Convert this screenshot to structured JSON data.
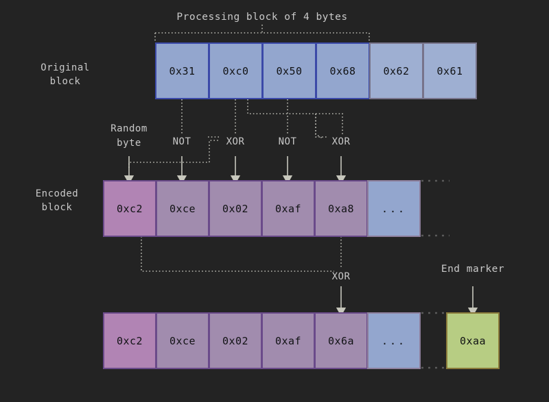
{
  "theme": {
    "background": "#232323",
    "text_light": "#c9c9c9",
    "text_dark": "#111214",
    "blue_fill": "#93a6ce",
    "blue_border_active": "#3b49a8",
    "blue_border_muted": "#77738a",
    "purple_fill_first": "#b184b4",
    "purple_fill": "#a18cae",
    "purple_border": "#6a4a8a",
    "green_fill": "#b7cd83",
    "green_border": "#8a7a3a",
    "connector": "#bdbdb5",
    "arrow": "#c8c8bd"
  },
  "captions": {
    "processing_block": "Processing block of 4 bytes",
    "end_marker": "End marker"
  },
  "rows": {
    "original": {
      "label_line1": "Original",
      "label_line2": "block",
      "cells": [
        {
          "value": "0x31",
          "state": "active"
        },
        {
          "value": "0xc0",
          "state": "active"
        },
        {
          "value": "0x50",
          "state": "active"
        },
        {
          "value": "0x68",
          "state": "active"
        },
        {
          "value": "0x62",
          "state": "muted"
        },
        {
          "value": "0x61",
          "state": "muted"
        }
      ]
    },
    "encoded": {
      "label_line1": "Encoded",
      "label_line2": "block",
      "cells": [
        {
          "value": "0xc2",
          "state": "first"
        },
        {
          "value": "0xce",
          "state": "normal"
        },
        {
          "value": "0x02",
          "state": "normal"
        },
        {
          "value": "0xaf",
          "state": "normal"
        },
        {
          "value": "0xa8",
          "state": "normal"
        },
        {
          "value": "...",
          "state": "ellipsis"
        }
      ]
    },
    "final": {
      "cells": [
        {
          "value": "0xc2",
          "state": "first"
        },
        {
          "value": "0xce",
          "state": "normal"
        },
        {
          "value": "0x02",
          "state": "normal"
        },
        {
          "value": "0xaf",
          "state": "normal"
        },
        {
          "value": "0x6a",
          "state": "normal"
        },
        {
          "value": "...",
          "state": "ellipsis"
        }
      ],
      "end_marker_cell": {
        "value": "0xaa",
        "state": "green"
      }
    }
  },
  "operations": {
    "random_byte_line1": "Random",
    "random_byte_line2": "byte",
    "op1": "NOT",
    "op2": "XOR",
    "op3": "NOT",
    "op4": "XOR",
    "op5": "XOR"
  }
}
